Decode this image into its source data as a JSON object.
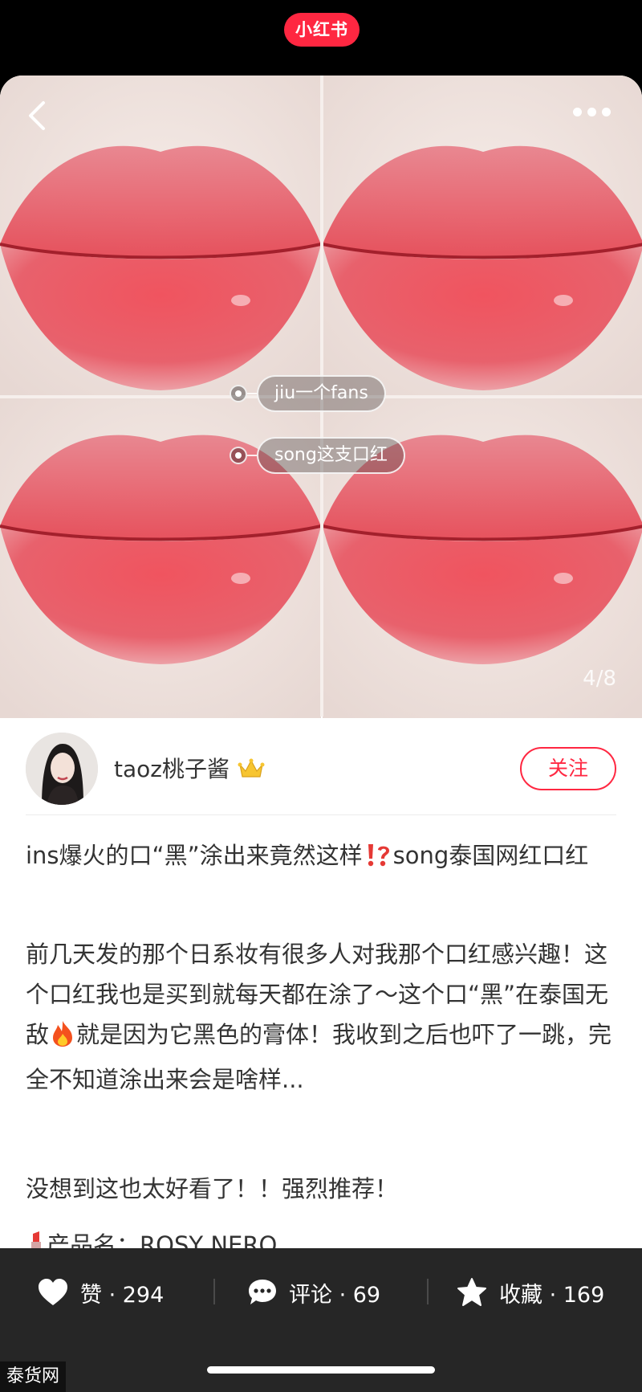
{
  "app": {
    "brand": "小红书"
  },
  "photo": {
    "tags": [
      "jiu一个fans",
      "song这支口红"
    ],
    "page_indicator": "4/8"
  },
  "author": {
    "name": "taoz桃子酱",
    "follow_label": "关注"
  },
  "post": {
    "title": "ins爆火的口“黑”涂出来竟然这样⁉️song泰国网红口红",
    "title_part1": "ins爆火的口“黑”涂出来竟然这样",
    "title_part2": "song泰国网红口红",
    "body_part1": "前几天发的那个日系妆有很多人对我那个口红感兴趣！这个口红我也是买到就每天都在涂了～这个口“黑”在泰国无敌",
    "body_part2": "就是因为它黑色的膏体！我收到之后也吓了一跳，完全不知道涂出来会是啥样...",
    "body_line2": "没想到这也太好看了！！强烈推荐！",
    "body_line3": "产品名：ROSY NERO"
  },
  "actions": {
    "like_label": "赞 · 294",
    "comment_label": "评论 · 69",
    "collect_label": "收藏 · 169"
  },
  "watermark": "泰货网",
  "colors": {
    "accent": "#ff2741",
    "bottom_bar": "#262626"
  }
}
